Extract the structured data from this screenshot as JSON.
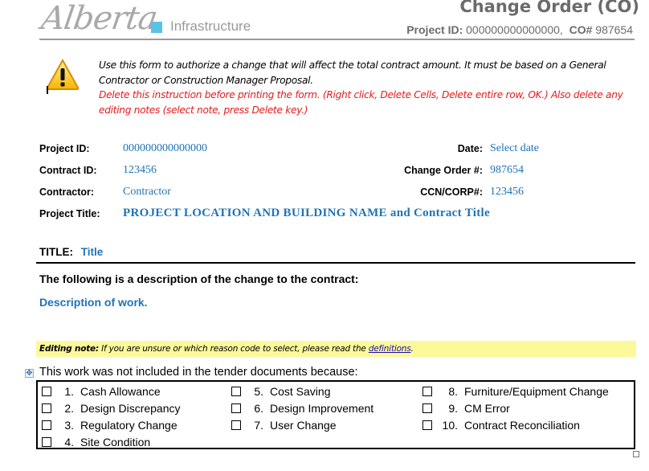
{
  "header": {
    "logo_script": "Alberta",
    "logo_dept": "Infrastructure",
    "doc_title": "Change Order (CO)",
    "sub_project_label": "Project ID:",
    "sub_project_value": "000000000000000,",
    "sub_co_label": "CO#",
    "sub_co_value": "987654"
  },
  "instruction": {
    "icon": "warning-icon",
    "line1": "Use this form to authorize a change that will affect the total contract amount. It must be based on a General Contractor or Construction Manager Proposal.",
    "line2": "Delete this instruction before printing the form. (Right click,  Delete Cells, Delete entire row, OK.) Also delete any editing notes (select note, press Delete key.)"
  },
  "fields": {
    "project_id_label": "Project ID:",
    "project_id_value": "000000000000000",
    "contract_id_label": "Contract ID:",
    "contract_id_value": "123456",
    "contractor_label": "Contractor:",
    "contractor_value": "Contractor",
    "project_title_label": "Project Title:",
    "project_title_value": "PROJECT LOCATION AND BUILDING NAME  and Contract Title",
    "date_label": "Date:",
    "date_value": "Select date",
    "change_order_label": "Change Order #:",
    "change_order_value": "987654",
    "ccn_label": "CCN/CORP#:",
    "ccn_value": "123456"
  },
  "title": {
    "label": "TITLE:",
    "value": "Title"
  },
  "description": {
    "heading": "The following is a description of the change to the contract:",
    "value": "Description of work."
  },
  "editing_note": {
    "label": "Editing note:",
    "text": " If you are unsure or which reason code to select, please read the ",
    "link": "definitions",
    "end": "."
  },
  "reasons": {
    "intro": "This work was not included in the tender documents because:",
    "items": [
      {
        "num": "1.",
        "label": "Cash Allowance",
        "checked": false
      },
      {
        "num": "2.",
        "label": "Design Discrepancy",
        "checked": false
      },
      {
        "num": "3.",
        "label": "Regulatory Change",
        "checked": false
      },
      {
        "num": "4.",
        "label": "Site Condition",
        "checked": false
      },
      {
        "num": "5.",
        "label": "Cost Saving",
        "checked": false
      },
      {
        "num": "6.",
        "label": "Design Improvement",
        "checked": false
      },
      {
        "num": "7.",
        "label": "User Change",
        "checked": false
      },
      {
        "num": "8.",
        "label": "Furniture/Equipment Change",
        "checked": false
      },
      {
        "num": "9.",
        "label": "CM Error",
        "checked": false
      },
      {
        "num": "10.",
        "label": "Contract Reconciliation",
        "checked": false
      }
    ]
  },
  "colors": {
    "field_value": "#1f73b7",
    "instruction_red": "#e41b1b",
    "note_highlight": "#fcf99b",
    "logo_accent": "#5bc2e7"
  }
}
